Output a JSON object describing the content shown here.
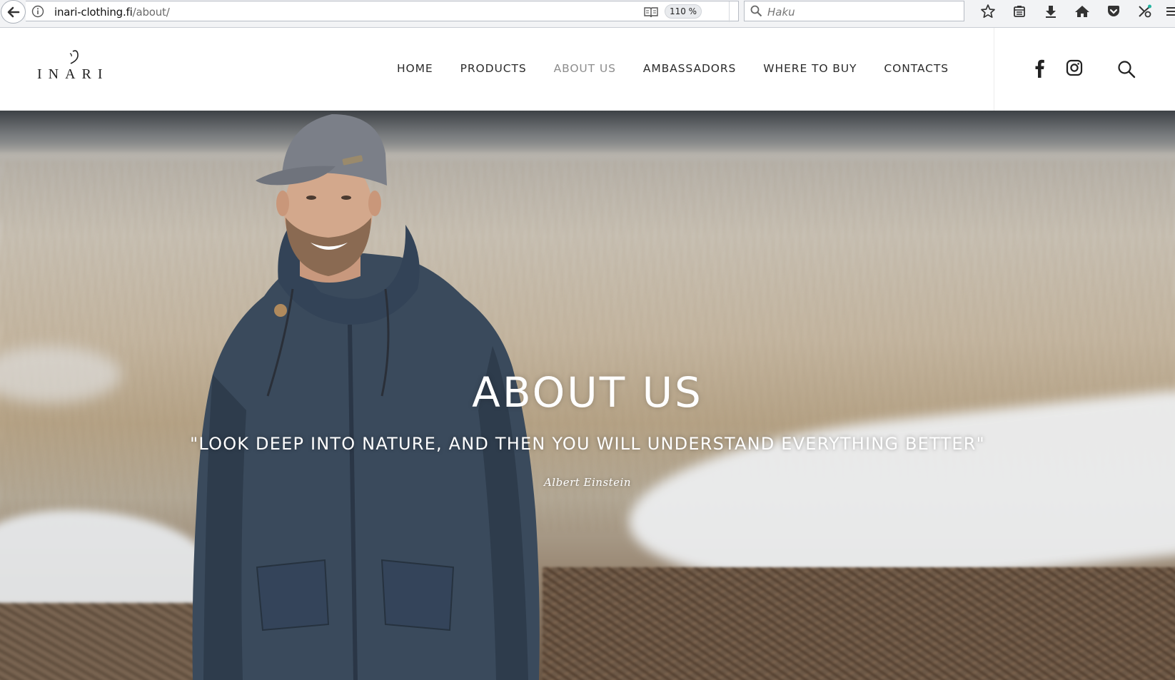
{
  "browser": {
    "url_domain": "inari-clothing.fi",
    "url_path": "/about/",
    "zoom": "110 %",
    "search_placeholder": "Haku",
    "toolbar_icons": [
      "bookmark-star-icon",
      "library-icon",
      "download-icon",
      "home-icon",
      "pocket-icon",
      "extension-icon",
      "menu-icon"
    ]
  },
  "header": {
    "logo_text": "INARI",
    "nav": [
      {
        "label": "HOME",
        "active": false
      },
      {
        "label": "PRODUCTS",
        "active": false
      },
      {
        "label": "ABOUT US",
        "active": true
      },
      {
        "label": "AMBASSADORS",
        "active": false
      },
      {
        "label": "WHERE TO BUY",
        "active": false
      },
      {
        "label": "CONTACTS",
        "active": false
      }
    ],
    "social": [
      "facebook-icon",
      "instagram-icon"
    ],
    "search_icon": "search-icon"
  },
  "hero": {
    "title": "ABOUT US",
    "quote": "\"LOOK DEEP INTO NATURE, AND THEN YOU WILL UNDERSTAND EVERYTHING BETTER\"",
    "author": "Albert Einstein"
  },
  "colors": {
    "nav_text": "#2b2b2b",
    "nav_active": "#8d8d8d",
    "hero_text": "#ffffff"
  }
}
